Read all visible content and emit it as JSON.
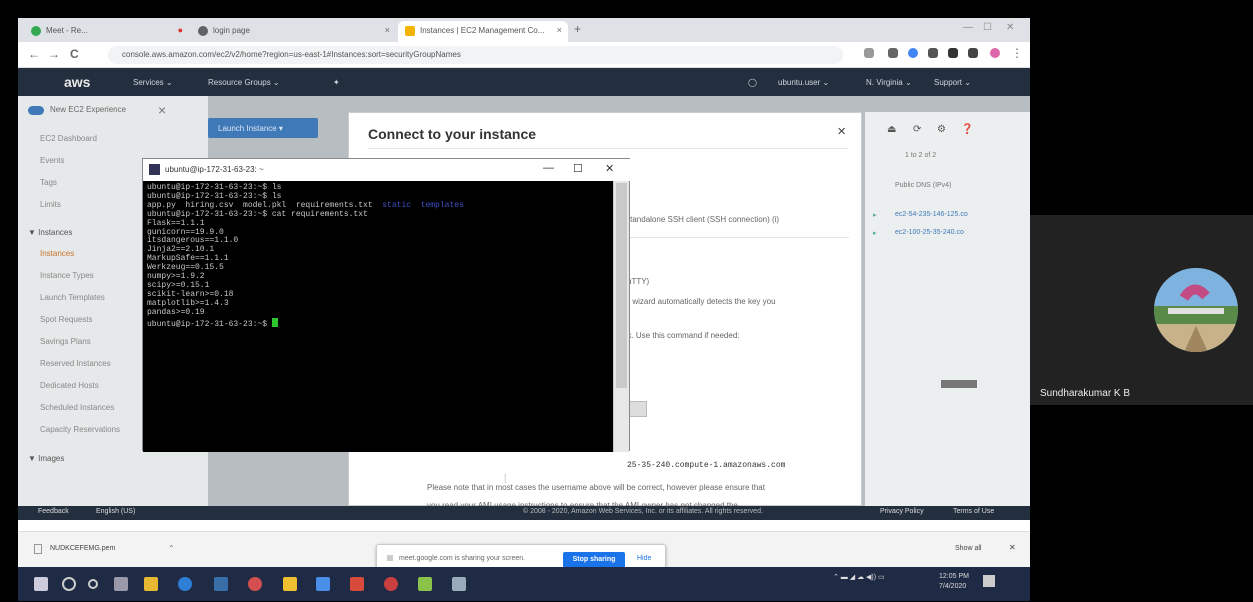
{
  "browser": {
    "tabs": [
      {
        "label": "Meet - Re...",
        "color": "#34a853"
      },
      {
        "label": "login page",
        "color": "#5f6368"
      },
      {
        "label": "Instances | EC2 Management Co...",
        "color": "#f4b400"
      }
    ],
    "new_tab": "+",
    "url": "console.aws.amazon.com/ec2/v2/home?region=us-east-1#Instances:sort=securityGroupNames",
    "back": "←",
    "forward": "→",
    "reload": "C"
  },
  "aws_header": {
    "logo": "aws",
    "services": "Services ⌄",
    "resource_groups": "Resource Groups ⌄",
    "pin": "✦",
    "user": "ubuntu.user ⌄",
    "region": "N. Virginia ⌄",
    "support": "Support ⌄"
  },
  "left_nav": {
    "new_ec2": "New EC2 Experience",
    "items": [
      "EC2 Dashboard",
      "Events",
      "Tags",
      "Limits",
      "▼ Instances",
      "Instances",
      "Instance Types",
      "Launch Templates",
      "Spot Requests",
      "Savings Plans",
      "Reserved Instances",
      "Dedicated Hosts",
      "Scheduled Instances",
      "Capacity Reservations",
      "▼ Images"
    ]
  },
  "launch_button": "Launch Instance ▾",
  "modal": {
    "title": "Connect to your instance",
    "close": "×",
    "lines": [
      "A standalone SSH client (SSH connection) (i)",
      "(PuTTY)",
      "the wizard automatically detects the key you",
      "ack. Use this command if needed:",
      "25-35-240.compute-1.amazonaws.com",
      "Please note that in most cases the username above will be correct, however please ensure that",
      "you read your AMI usage instructions to ensure that the AMI owner has not changed the"
    ]
  },
  "right_panel": {
    "pager": "1 to 2 of 2",
    "column": "Public DNS (IPv4)",
    "rows": [
      "ec2-54-235-146-125.co",
      "ec2-100-25-35-240.co"
    ]
  },
  "putty": {
    "title": "ubuntu@ip-172-31-63-23: ~",
    "min": "—",
    "max": "☐",
    "close": "✕",
    "lines": [
      {
        "text": "ubuntu@ip-172-31-63-23:~$ ls",
        "blue": ""
      },
      {
        "text": "ubuntu@ip-172-31-63-23:~$ ls",
        "blue": ""
      },
      {
        "text": "app.py  hiring.csv  model.pkl  requirements.txt  ",
        "blue": "static  templates"
      },
      {
        "text": "ubuntu@ip-172-31-63-23:~$ cat requirements.txt",
        "blue": ""
      },
      {
        "text": "Flask==1.1.1",
        "blue": ""
      },
      {
        "text": "gunicorn==19.9.0",
        "blue": ""
      },
      {
        "text": "itsdangerous==1.1.0",
        "blue": ""
      },
      {
        "text": "Jinja2==2.10.1",
        "blue": ""
      },
      {
        "text": "MarkupSafe==1.1.1",
        "blue": ""
      },
      {
        "text": "Werkzeug==0.15.5",
        "blue": ""
      },
      {
        "text": "numpy>=1.9.2",
        "blue": ""
      },
      {
        "text": "scipy>=0.15.1",
        "blue": ""
      },
      {
        "text": "scikit-learn>=0.18",
        "blue": ""
      },
      {
        "text": "matplotlib>=1.4.3",
        "blue": ""
      },
      {
        "text": "pandas>=0.19",
        "blue": ""
      },
      {
        "text": "ubuntu@ip-172-31-63-23:~$ ",
        "blue": ""
      }
    ]
  },
  "footer": {
    "feedback": "Feedback",
    "language": "English (US)",
    "copyright": "© 2008 - 2020, Amazon Web Services, Inc. or its affiliates. All rights reserved.",
    "privacy": "Privacy Policy",
    "terms": "Terms of Use"
  },
  "downloads": {
    "file": "NUDKCEFEMG.pem",
    "show_all": "Show all",
    "close": "✕"
  },
  "share_bar": {
    "message": "meet.google.com is sharing your screen.",
    "stop": "Stop sharing",
    "hide": "Hide"
  },
  "tray": {
    "time": "12:05 PM",
    "date": "7/4/2020"
  },
  "participant": {
    "name": "Sundharakumar K B"
  }
}
